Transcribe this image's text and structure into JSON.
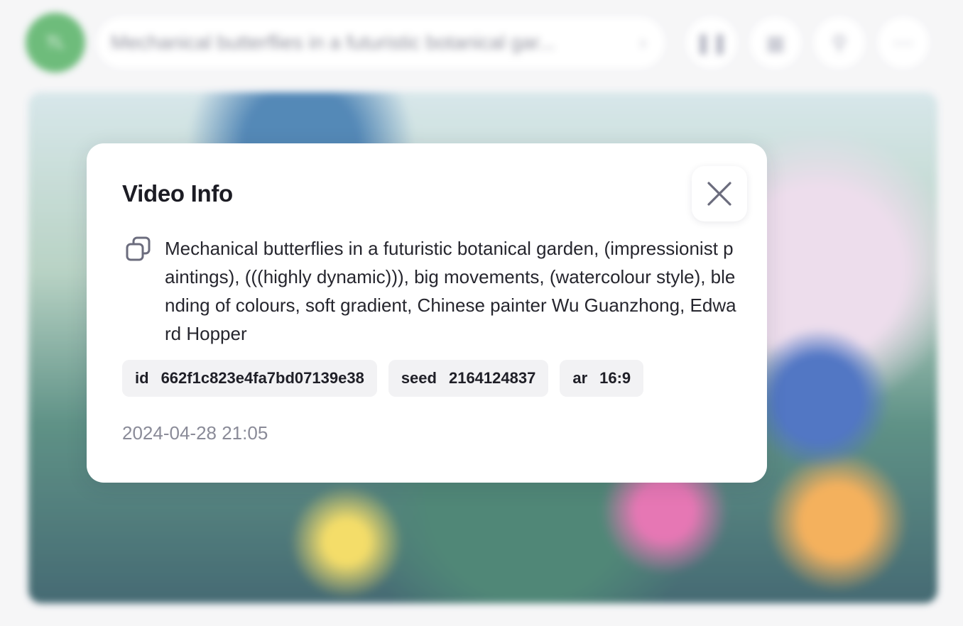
{
  "header": {
    "avatar_initials": "TL",
    "prompt_preview": "Mechanical butterflies in a futuristic botanical gar...",
    "chevron_icon": "chevron-right-icon",
    "toolbar_icons": [
      "pause-icon",
      "grid-icon",
      "search-icon",
      "more-icon"
    ]
  },
  "modal": {
    "title": "Video Info",
    "close_icon": "close-icon",
    "copy_icon": "copy-icon",
    "prompt": "Mechanical butterflies in a futuristic botanical garden, (impressionist paintings), (((highly dynamic))), big movements, (watercolour style), blending of colours, soft gradient, Chinese painter Wu Guanzhong, Edward Hopper",
    "chips": [
      {
        "key": "id",
        "value": "662f1c823e4fa7bd07139e38"
      },
      {
        "key": "seed",
        "value": "2164124837"
      },
      {
        "key": "ar",
        "value": "16:9"
      }
    ],
    "timestamp": "2024-04-28 21:05"
  },
  "colors": {
    "avatar": "#4fae5f",
    "modal_bg": "#ffffff",
    "chip_bg": "#f2f2f4",
    "timestamp": "#8a8b98"
  }
}
